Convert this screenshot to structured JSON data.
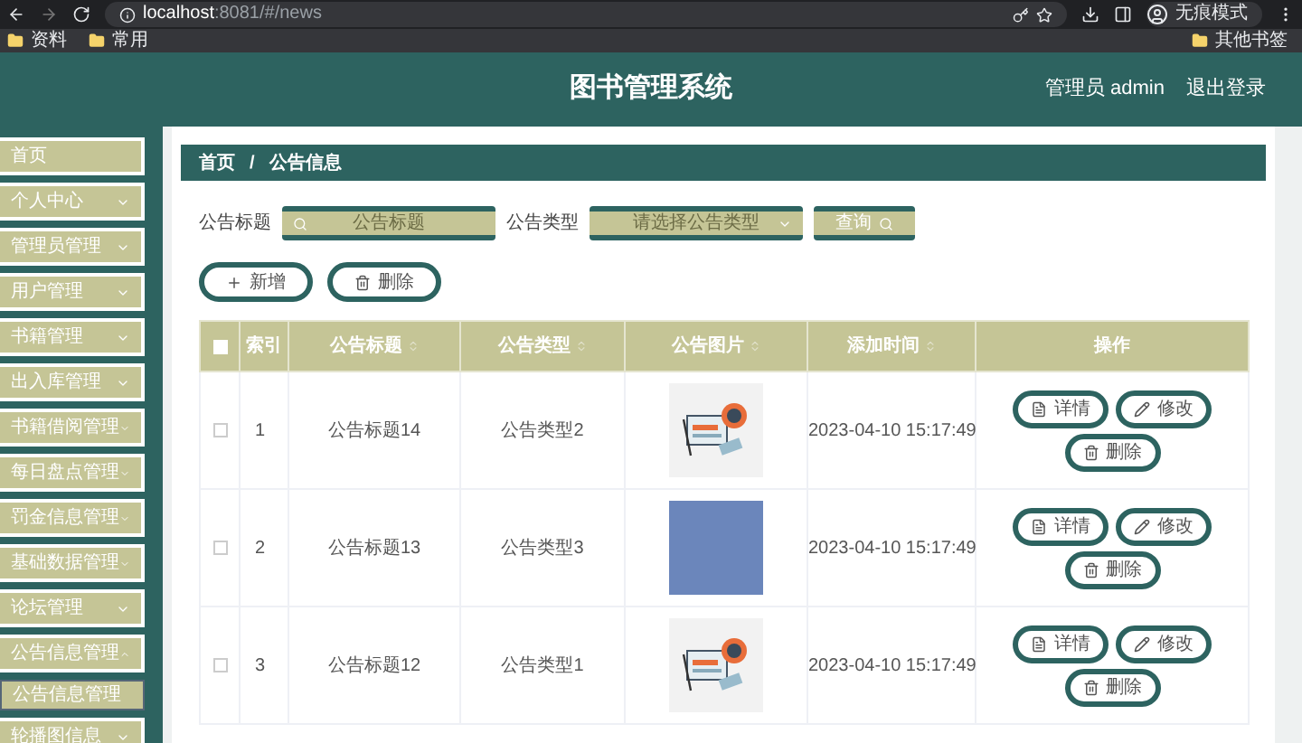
{
  "browser": {
    "url_host": "localhost",
    "url_rest": ":8081/#/news",
    "bookmarks": [
      "资料",
      "常用"
    ],
    "other_bookmarks": "其他书签",
    "profile_label": "无痕模式"
  },
  "header": {
    "title": "图书管理系统",
    "user": "管理员 admin",
    "logout": "退出登录"
  },
  "sidebar": {
    "items": [
      {
        "label": "首页",
        "has_children": false
      },
      {
        "label": "个人中心",
        "has_children": true,
        "expanded": false
      },
      {
        "label": "管理员管理",
        "has_children": true,
        "expanded": false
      },
      {
        "label": "用户管理",
        "has_children": true,
        "expanded": false
      },
      {
        "label": "书籍管理",
        "has_children": true,
        "expanded": false
      },
      {
        "label": "出入库管理",
        "has_children": true,
        "expanded": false
      },
      {
        "label": "书籍借阅管理",
        "has_children": true,
        "expanded": false
      },
      {
        "label": "每日盘点管理",
        "has_children": true,
        "expanded": false
      },
      {
        "label": "罚金信息管理",
        "has_children": true,
        "expanded": false
      },
      {
        "label": "基础数据管理",
        "has_children": true,
        "expanded": false
      },
      {
        "label": "论坛管理",
        "has_children": true,
        "expanded": false
      },
      {
        "label": "公告信息管理",
        "has_children": true,
        "expanded": true,
        "children": [
          {
            "label": "公告信息管理"
          }
        ]
      },
      {
        "label": "轮播图信息",
        "has_children": true,
        "expanded": false
      }
    ]
  },
  "breadcrumb": {
    "items": [
      "首页",
      "公告信息"
    ],
    "separator": "/"
  },
  "search": {
    "fields": [
      {
        "kind": "input",
        "label": "公告标题",
        "placeholder": "公告标题"
      },
      {
        "kind": "select",
        "label": "公告类型",
        "placeholder": "请选择公告类型"
      }
    ],
    "button": "查询"
  },
  "actions": [
    {
      "kind": "add",
      "label": "新增"
    },
    {
      "kind": "delete",
      "label": "删除"
    }
  ],
  "table": {
    "header_checked": false,
    "columns": [
      {
        "label": "索引",
        "sortable": false
      },
      {
        "label": "公告标题",
        "sortable": true
      },
      {
        "label": "公告类型",
        "sortable": true
      },
      {
        "label": "公告图片",
        "sortable": true
      },
      {
        "label": "添加时间",
        "sortable": true
      },
      {
        "label": "操作",
        "sortable": false
      }
    ],
    "rows": [
      {
        "checked": false,
        "index": "1",
        "title": "公告标题14",
        "type": "公告类型2",
        "image": {
          "kind": "illustration"
        },
        "time": "2023-04-10 15:17:49",
        "actions": [
          {
            "kind": "detail",
            "label": "详情"
          },
          {
            "kind": "edit",
            "label": "修改"
          },
          {
            "kind": "delete",
            "label": "删除"
          }
        ]
      },
      {
        "checked": false,
        "index": "2",
        "title": "公告标题13",
        "type": "公告类型3",
        "image": {
          "kind": "photo"
        },
        "time": "2023-04-10 15:17:49",
        "actions": [
          {
            "kind": "detail",
            "label": "详情"
          },
          {
            "kind": "edit",
            "label": "修改"
          },
          {
            "kind": "delete",
            "label": "删除"
          }
        ]
      },
      {
        "checked": false,
        "index": "3",
        "title": "公告标题12",
        "type": "公告类型1",
        "image": {
          "kind": "illustration"
        },
        "time": "2023-04-10 15:17:49",
        "actions": [
          {
            "kind": "detail",
            "label": "详情"
          },
          {
            "kind": "edit",
            "label": "修改"
          },
          {
            "kind": "delete",
            "label": "删除"
          }
        ]
      }
    ]
  }
}
